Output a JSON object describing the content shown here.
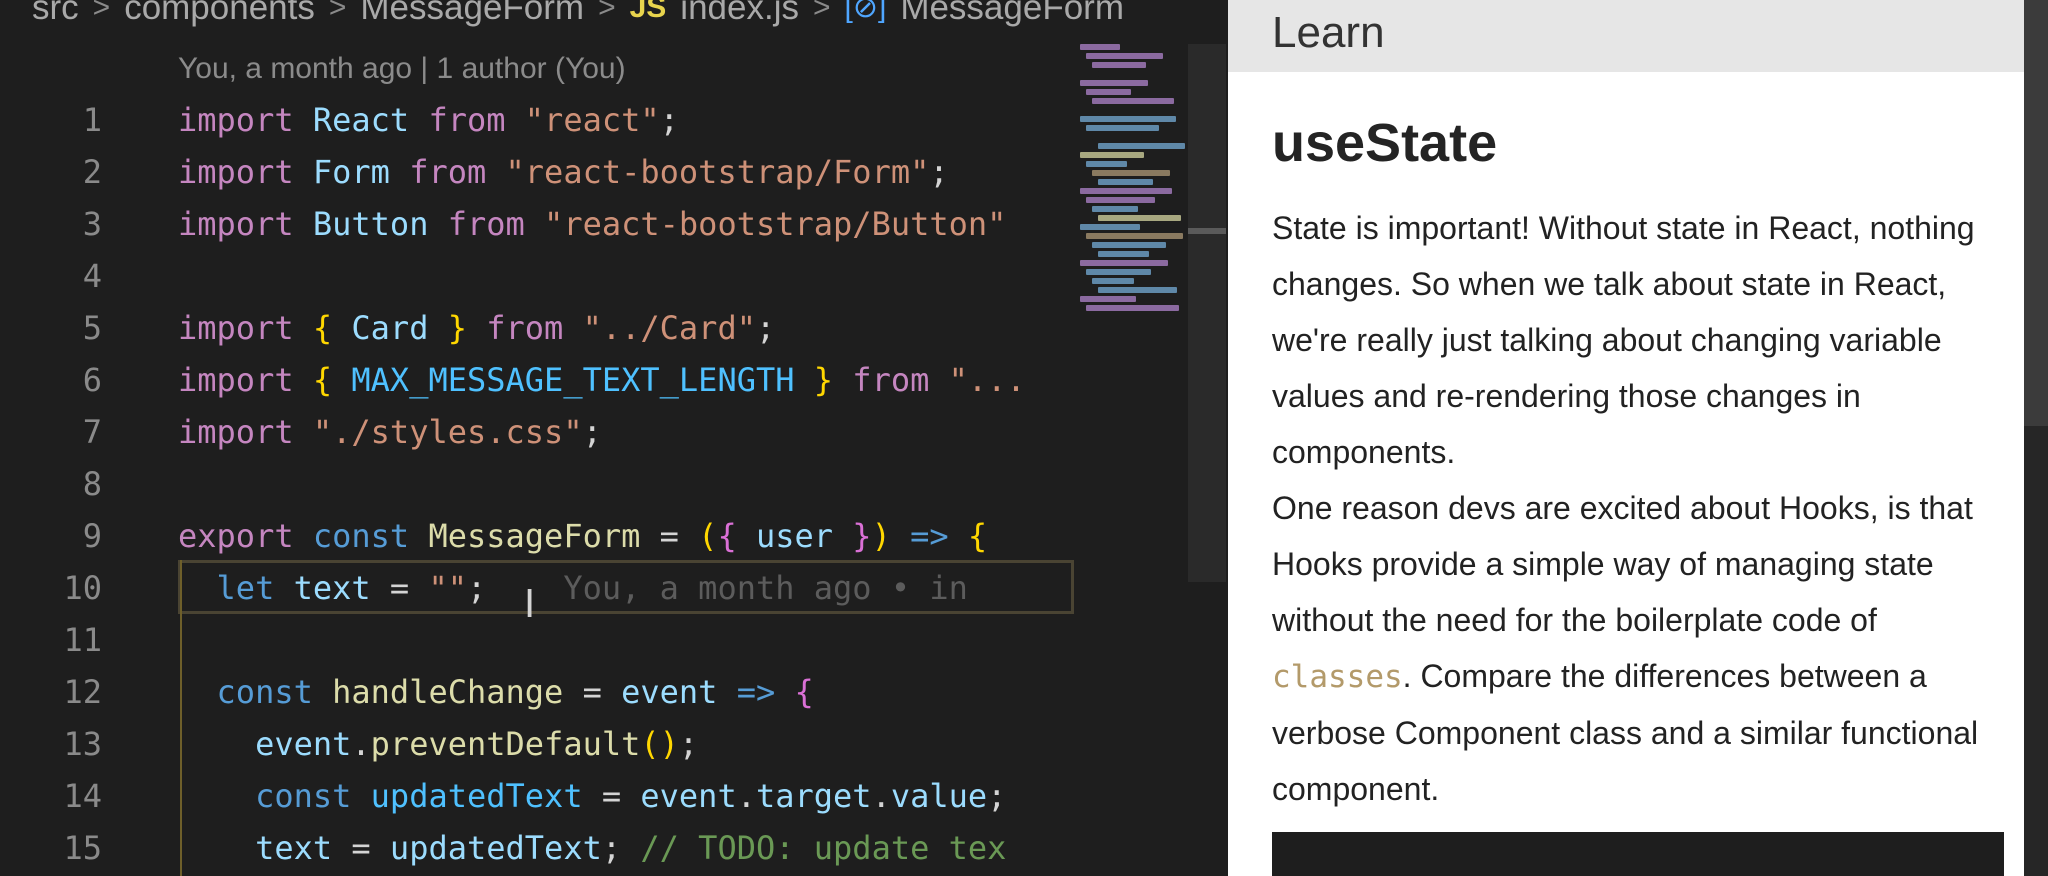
{
  "breadcrumb": {
    "items": [
      "src",
      "components",
      "MessageForm",
      "index.js",
      "MessageForm"
    ],
    "separator": ">",
    "file_badge": "JS",
    "symbol_icon": "[⊘]"
  },
  "codelens": "You, a month ago | 1 author (You)",
  "code_lines": [
    {
      "n": "1",
      "tokens": [
        [
          "kw",
          "import "
        ],
        [
          "id",
          "React"
        ],
        [
          "kw",
          " from "
        ],
        [
          "st",
          "\"react\""
        ],
        [
          "op",
          ";"
        ]
      ]
    },
    {
      "n": "2",
      "tokens": [
        [
          "kw",
          "import "
        ],
        [
          "id",
          "Form"
        ],
        [
          "kw",
          " from "
        ],
        [
          "st",
          "\"react-bootstrap/Form\""
        ],
        [
          "op",
          ";"
        ]
      ]
    },
    {
      "n": "3",
      "tokens": [
        [
          "kw",
          "import "
        ],
        [
          "id",
          "Button"
        ],
        [
          "kw",
          " from "
        ],
        [
          "st",
          "\"react-bootstrap/Button\""
        ]
      ]
    },
    {
      "n": "4",
      "tokens": []
    },
    {
      "n": "5",
      "tokens": [
        [
          "kw",
          "import "
        ],
        [
          "br1",
          "{ "
        ],
        [
          "id",
          "Card"
        ],
        [
          "br1",
          " }"
        ],
        [
          "kw",
          " from "
        ],
        [
          "st",
          "\"../Card\""
        ],
        [
          "op",
          ";"
        ]
      ]
    },
    {
      "n": "6",
      "tokens": [
        [
          "kw",
          "import "
        ],
        [
          "br1",
          "{ "
        ],
        [
          "cn",
          "MAX_MESSAGE_TEXT_LENGTH"
        ],
        [
          "br1",
          " }"
        ],
        [
          "kw",
          " from "
        ],
        [
          "st",
          "\"..."
        ]
      ]
    },
    {
      "n": "7",
      "tokens": [
        [
          "kw",
          "import "
        ],
        [
          "st",
          "\"./styles.css\""
        ],
        [
          "op",
          ";"
        ]
      ]
    },
    {
      "n": "8",
      "tokens": []
    },
    {
      "n": "9",
      "tokens": [
        [
          "kw",
          "export "
        ],
        [
          "kwb",
          "const "
        ],
        [
          "fn",
          "MessageForm"
        ],
        [
          "op",
          " = "
        ],
        [
          "br1",
          "("
        ],
        [
          "br2",
          "{ "
        ],
        [
          "id",
          "user"
        ],
        [
          "br2",
          " }"
        ],
        [
          "br1",
          ")"
        ],
        [
          "kwb",
          " => "
        ],
        [
          "br1",
          "{"
        ]
      ]
    },
    {
      "n": "10",
      "tokens": [
        [
          "op",
          "  "
        ],
        [
          "kwb",
          "let "
        ],
        [
          "id",
          "text"
        ],
        [
          "op",
          " = "
        ],
        [
          "st",
          "\"\""
        ],
        [
          "op",
          ";"
        ],
        [
          "ghost",
          "    You, a month ago • in"
        ]
      ]
    },
    {
      "n": "11",
      "tokens": []
    },
    {
      "n": "12",
      "tokens": [
        [
          "op",
          "  "
        ],
        [
          "kwb",
          "const "
        ],
        [
          "fn",
          "handleChange"
        ],
        [
          "op",
          " = "
        ],
        [
          "id",
          "event"
        ],
        [
          "kwb",
          " => "
        ],
        [
          "br2",
          "{"
        ]
      ]
    },
    {
      "n": "13",
      "tokens": [
        [
          "op",
          "    "
        ],
        [
          "id",
          "event"
        ],
        [
          "op",
          "."
        ],
        [
          "fn",
          "preventDefault"
        ],
        [
          "br1",
          "()"
        ],
        [
          "op",
          ";"
        ]
      ]
    },
    {
      "n": "14",
      "tokens": [
        [
          "op",
          "    "
        ],
        [
          "kwb",
          "const "
        ],
        [
          "cn",
          "updatedText"
        ],
        [
          "op",
          " = "
        ],
        [
          "id",
          "event"
        ],
        [
          "op",
          "."
        ],
        [
          "id",
          "target"
        ],
        [
          "op",
          "."
        ],
        [
          "id",
          "value"
        ],
        [
          "op",
          ";"
        ]
      ]
    },
    {
      "n": "15",
      "tokens": [
        [
          "op",
          "    "
        ],
        [
          "id",
          "text"
        ],
        [
          "op",
          " = "
        ],
        [
          "id",
          "updatedText"
        ],
        [
          "op",
          "; "
        ],
        [
          "cm",
          "// TODO: update tex"
        ]
      ]
    }
  ],
  "learn": {
    "header": "Learn",
    "title": "useState",
    "para1": "State is important! Without state in React, nothing changes. So when we talk about state in React, we're really just talking about changing variable values and re-rendering those changes in components.",
    "para2_before": "One reason devs are excited about Hooks, is that Hooks provide a simple way of managing state without the need for the boilerplate code of ",
    "para2_code": "classes",
    "para2_after": ". Compare the differences between a verbose Component class and a similar functional component."
  },
  "colors": {
    "editor_bg": "#1e1e1e",
    "panel_bg": "#ffffff",
    "panel_header_bg": "#e6e6e6"
  }
}
